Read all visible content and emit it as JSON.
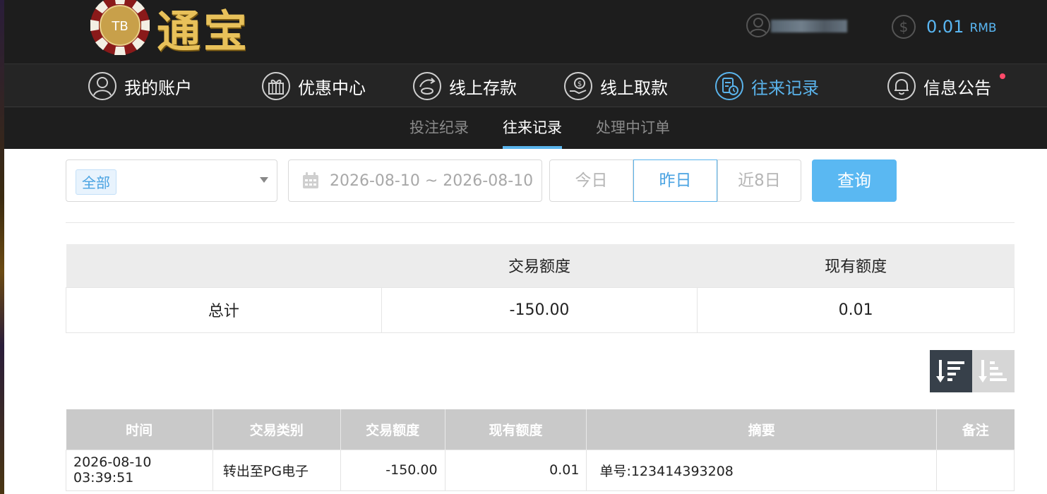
{
  "header": {
    "logo_badge": "TB",
    "logo_text": "通宝",
    "balance_value": "0.01",
    "balance_currency": "RMB"
  },
  "nav": {
    "items": [
      {
        "label": "我的账户",
        "icon": "user-circle-icon"
      },
      {
        "label": "优惠中心",
        "icon": "gift-icon"
      },
      {
        "label": "线上存款",
        "icon": "deposit-icon"
      },
      {
        "label": "线上取款",
        "icon": "withdraw-icon"
      },
      {
        "label": "往来记录",
        "icon": "records-icon",
        "active": true
      },
      {
        "label": "信息公告",
        "icon": "bell-icon"
      }
    ]
  },
  "subnav": {
    "items": [
      {
        "label": "投注纪录"
      },
      {
        "label": "往来记录",
        "active": true
      },
      {
        "label": "处理中订单"
      }
    ]
  },
  "filters": {
    "type_selected": "全部",
    "date_range": "2026-08-10 ~ 2026-08-10",
    "quick": [
      "今日",
      "昨日",
      "近8日"
    ],
    "quick_active": "昨日",
    "query_label": "查询"
  },
  "summary": {
    "headers": [
      "",
      "交易额度",
      "现有额度"
    ],
    "row": [
      "总计",
      "-150.00",
      "0.01"
    ]
  },
  "records": {
    "headers": [
      "时间",
      "交易类别",
      "交易额度",
      "现有额度",
      "摘要",
      "备注"
    ],
    "rows": [
      [
        "2026-08-10 03:39:51",
        "转出至PG电子",
        "-150.00",
        "0.01",
        "单号:123414393208",
        ""
      ]
    ]
  },
  "colors": {
    "accent": "#5ab4ec",
    "header_bg": "#1d1d1d",
    "nav_bg": "#252525",
    "query_button": "#5ab8f2",
    "notification_dot": "#ff4a6a"
  }
}
